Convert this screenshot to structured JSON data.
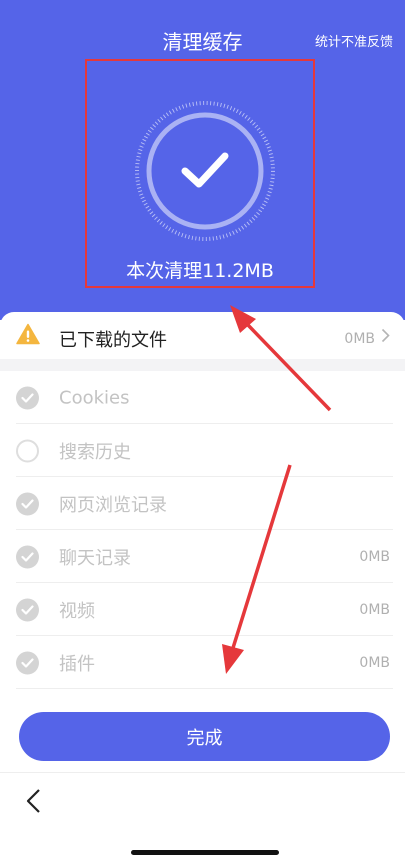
{
  "header": {
    "title": "清理缓存",
    "feedback_label": "统计不准反馈",
    "result_text": "本次清理11.2MB",
    "bg_color": "#5564e8"
  },
  "downloaded": {
    "label": "已下载的文件",
    "size": "0MB",
    "icon": "warning-icon"
  },
  "items": [
    {
      "label": "Cookies",
      "checked": true,
      "size": ""
    },
    {
      "label": "搜索历史",
      "checked": false,
      "size": ""
    },
    {
      "label": "网页浏览记录",
      "checked": true,
      "size": ""
    },
    {
      "label": "聊天记录",
      "checked": true,
      "size": "0MB"
    },
    {
      "label": "视频",
      "checked": true,
      "size": "0MB"
    },
    {
      "label": "插件",
      "checked": true,
      "size": "0MB"
    }
  ],
  "done_label": "完成",
  "annotation_color": "#e5383b"
}
